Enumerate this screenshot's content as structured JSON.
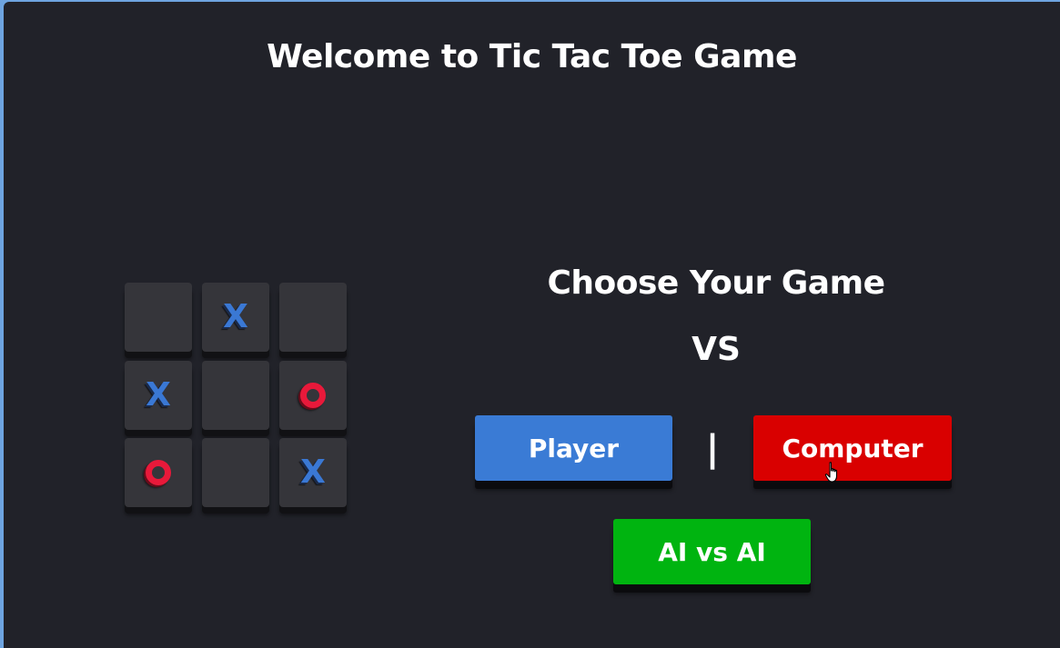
{
  "header": {
    "title": "Welcome to Tic Tac Toe Game"
  },
  "board": {
    "cells": [
      "",
      "X",
      "",
      "X",
      "",
      "O",
      "O",
      "",
      "X"
    ],
    "colors": {
      "x": "#3a78d4",
      "o": "#e8193a",
      "cell": "#35353a"
    }
  },
  "menu": {
    "heading": "Choose Your Game",
    "vs_label": "VS",
    "separator": "|",
    "player_label": "Player",
    "computer_label": "Computer",
    "ai_label": "AI vs AI",
    "colors": {
      "player": "#3a7bd5",
      "computer": "#d90000",
      "ai": "#00b410"
    }
  },
  "icons": {
    "cursor": "hand-pointer-icon"
  }
}
